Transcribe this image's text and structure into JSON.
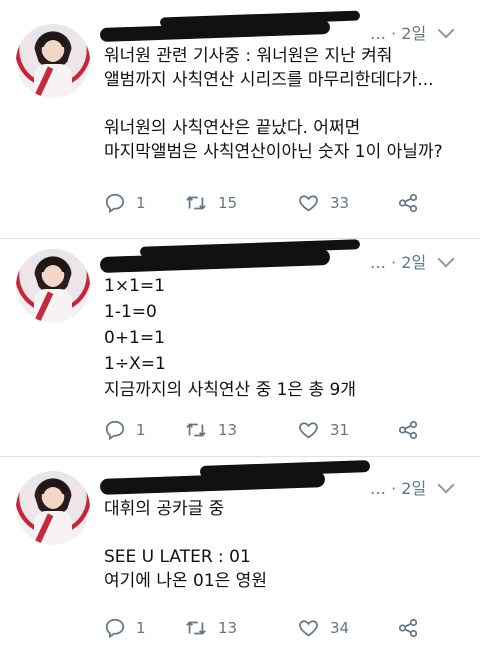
{
  "tweets": [
    {
      "time": "2일",
      "text": "워너원 관련 기사중 : 워너원은 지난 켜줘\n앨범까지 사칙연산 시리즈를 마무리한데다가...\n\n워너원의 사칙연산은 끝났다. 어쩌면\n마지막앨범은 사칙연산이아닌 숫자 1이 아닐까?",
      "reply_count": "1",
      "retweet_count": "15",
      "like_count": "33"
    },
    {
      "time": "2일",
      "text": "1×1=1\n1-1=0\n0+1=1\n1÷X=1\n지금까지의 사칙연산 중 1은 총 9개",
      "reply_count": "1",
      "retweet_count": "13",
      "like_count": "31"
    },
    {
      "time": "2일",
      "text": "대휘의 공카글 중\n\nSEE U LATER : 01\n여기에 나온 01은 영원",
      "reply_count": "1",
      "retweet_count": "13",
      "like_count": "34"
    }
  ],
  "meta_prefix": "… · ",
  "icons": {
    "reply": "reply-icon",
    "retweet": "retweet-icon",
    "like": "heart-icon",
    "share": "share-icon",
    "menu": "chevron-down-icon"
  },
  "colors": {
    "meta": "#657786",
    "icon": "#657786",
    "redaction": "#111111"
  }
}
